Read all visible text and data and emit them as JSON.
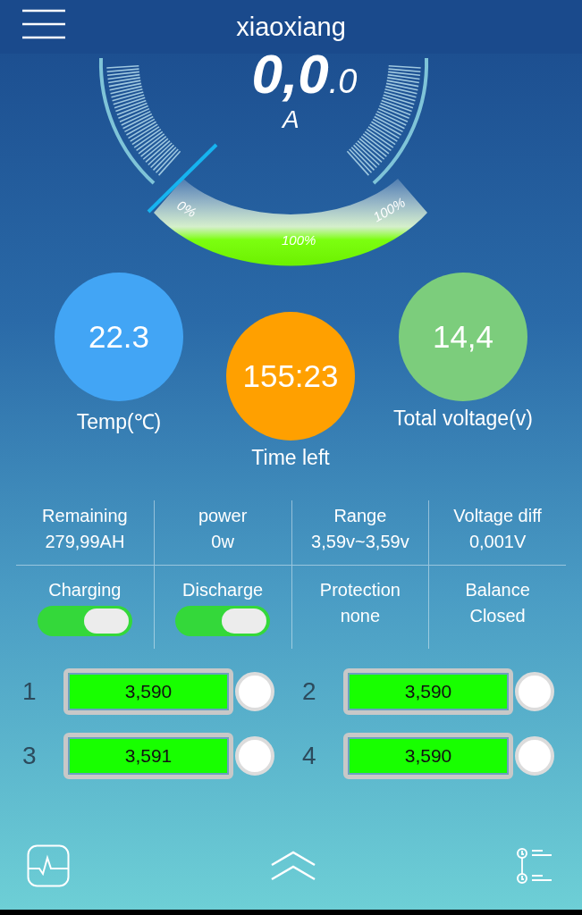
{
  "header": {
    "title": "xiaoxiang"
  },
  "gauge": {
    "value": "0,0",
    "decimal": ".0",
    "unit": "A",
    "scale_labels": [
      "0%",
      "100%",
      "100%"
    ]
  },
  "circles": [
    {
      "value": "22.3",
      "label": "Temp(℃)",
      "color": "#42a5f5"
    },
    {
      "value": "155:23",
      "label": "Time left",
      "color": "#ffa000"
    },
    {
      "value": "14,4",
      "label": "Total voltage(v)",
      "color": "#7ccd7c"
    }
  ],
  "stats": [
    {
      "label": "Remaining",
      "value": "279,99AH"
    },
    {
      "label": "power",
      "value": "0w"
    },
    {
      "label": "Range",
      "value": "3,59v~3,59v"
    },
    {
      "label": "Voltage diff",
      "value": "0,001V"
    }
  ],
  "controls": [
    {
      "kind": "switch",
      "label": "Charging",
      "on": true
    },
    {
      "kind": "switch",
      "label": "Discharge",
      "on": true
    },
    {
      "kind": "text",
      "label": "Protection",
      "value": "none"
    },
    {
      "kind": "text",
      "label": "Balance",
      "value": "Closed"
    }
  ],
  "cells": [
    {
      "index": "1",
      "voltage": "3,590"
    },
    {
      "index": "2",
      "voltage": "3,590"
    },
    {
      "index": "3",
      "voltage": "3,591"
    },
    {
      "index": "4",
      "voltage": "3,590"
    }
  ]
}
